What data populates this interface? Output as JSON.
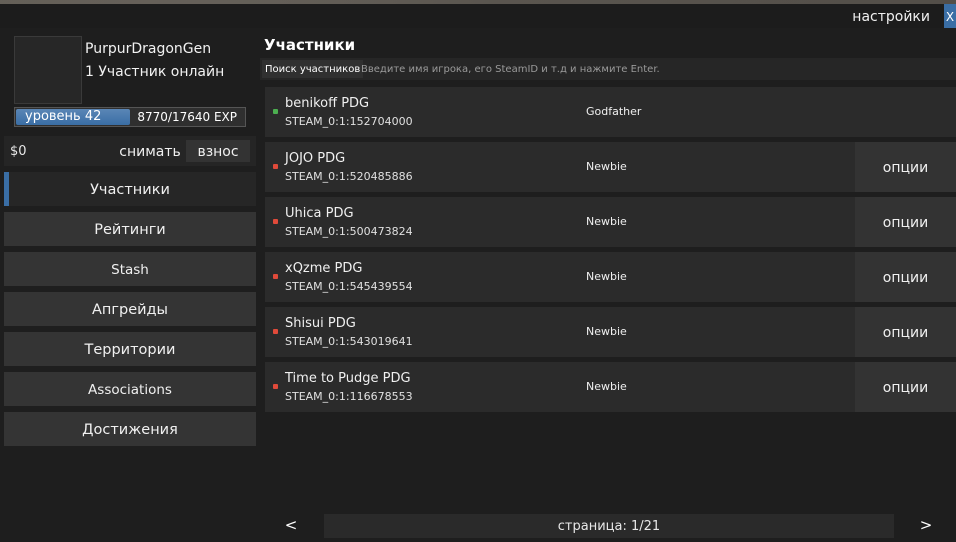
{
  "topbar": {
    "settings_label": "настройки",
    "close_label": "X"
  },
  "profile": {
    "username": "PurpurDragonGen",
    "online_text": "1 Участник онлайн",
    "level_label": "уровень 42",
    "exp_text": "8770/17640 EXP",
    "exp_progress": 0.497
  },
  "bank": {
    "money": "$0",
    "withdraw_label": "снимать",
    "deposit_label": "взнос"
  },
  "nav": {
    "items": [
      {
        "label": "Участники",
        "active": true
      },
      {
        "label": "Рейтинги"
      },
      {
        "label": "Stash"
      },
      {
        "label": "Апгрейды"
      },
      {
        "label": "Территории"
      },
      {
        "label": "Associations"
      },
      {
        "label": "Достижения"
      }
    ]
  },
  "main": {
    "title": "Участники",
    "search_label": "Поиск участников",
    "search_placeholder": "Введите имя игрока, его SteamID и т.д и нажмите Enter."
  },
  "members": [
    {
      "name": "benikoff PDG",
      "steam": "STEAM_0:1:152704000",
      "rank": "Godfather",
      "status": "online",
      "options": ""
    },
    {
      "name": "JOJO PDG",
      "steam": "STEAM_0:1:520485886",
      "rank": "Newbie",
      "status": "offline",
      "options": "опции"
    },
    {
      "name": "Uhica PDG",
      "steam": "STEAM_0:1:500473824",
      "rank": "Newbie",
      "status": "offline",
      "options": "опции"
    },
    {
      "name": "xQzme PDG",
      "steam": "STEAM_0:1:545439554",
      "rank": "Newbie",
      "status": "offline",
      "options": "опции"
    },
    {
      "name": "Shisui PDG",
      "steam": "STEAM_0:1:543019641",
      "rank": "Newbie",
      "status": "offline",
      "options": "опции"
    },
    {
      "name": "Time to Pudge PDG",
      "steam": "STEAM_0:1:116678553",
      "rank": "Newbie",
      "status": "offline",
      "options": "опции"
    }
  ],
  "pagination": {
    "prev_label": "<",
    "page_label": "страница: 1/21",
    "next_label": ">"
  },
  "colors": {
    "accent": "#3a6ea5",
    "online": "#4caf50",
    "offline": "#e04a3a"
  }
}
